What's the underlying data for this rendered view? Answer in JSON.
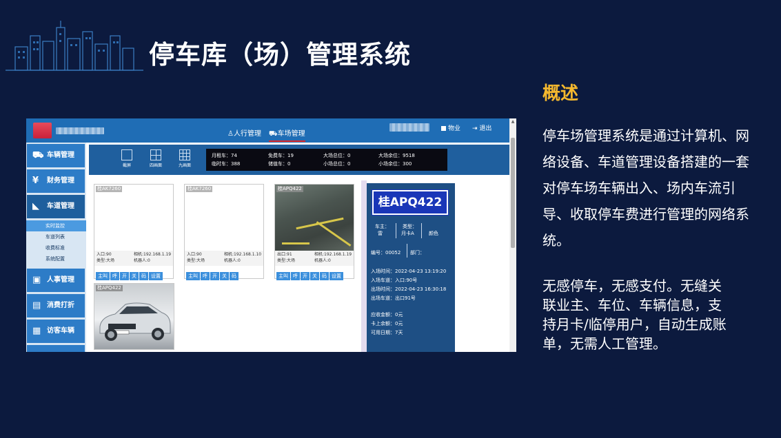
{
  "slide": {
    "title": "停车库（场）管理系统",
    "section_title": "概述",
    "paragraph_1": "停车场管理系统是通过计算机、网络设备、车道管理设备搭建的一套对停车场车辆出入、场内车流引导、收取停车费进行管理的网络系统。",
    "paragraph_2": "无感停车，无感支付。无缝关联业主、车位、车辆信息，支持月卡/临停用户，自动生成账单，无需人工管理。"
  },
  "app": {
    "nav": [
      {
        "label": "人行管理",
        "icon": "person-icon"
      },
      {
        "label": "车场管理",
        "icon": "car-icon",
        "active": true
      }
    ],
    "header_links": [
      {
        "label": "物业",
        "icon": "square-icon"
      },
      {
        "label": "退出",
        "icon": "exit-icon"
      }
    ],
    "sidebar": {
      "items": [
        {
          "label": "车辆管理",
          "icon": "car-icon"
        },
        {
          "label": "财务管理",
          "icon": "yen-icon"
        },
        {
          "label": "车道管理",
          "icon": "camera-icon"
        },
        {
          "label": "人事管理",
          "icon": "id-card-icon"
        },
        {
          "label": "消费打折",
          "icon": "discount-icon"
        },
        {
          "label": "访客车辆",
          "icon": "visitor-icon"
        }
      ],
      "sub_items": [
        {
          "label": "实时监控",
          "active": true
        },
        {
          "label": "车道列表"
        },
        {
          "label": "收费标准"
        },
        {
          "label": "系统配置"
        }
      ]
    },
    "toolbar": {
      "tools": [
        {
          "label": "截屏",
          "icon": "screenshot-icon"
        },
        {
          "label": "四画面",
          "icon": "grid-4-icon"
        },
        {
          "label": "九画面",
          "icon": "grid-9-icon"
        }
      ],
      "stats": [
        {
          "label": "月租车：",
          "value": "74"
        },
        {
          "label": "临时车：",
          "value": "388"
        },
        {
          "label": "免费车：",
          "value": "19"
        },
        {
          "label": "储值车：",
          "value": "0"
        },
        {
          "label": "大场总位：",
          "value": "0"
        },
        {
          "label": "小场总位：",
          "value": "0"
        },
        {
          "label": "大场余位：",
          "value": "9518"
        },
        {
          "label": "小场余位：",
          "value": "300"
        }
      ]
    },
    "cameras": [
      {
        "tag": "桂AK7260",
        "lane": "入口:90",
        "ip": "相机:192.168.1.19",
        "type": "类型:大场",
        "robot": "机器人:0",
        "buttons": [
          "主叫",
          "呼",
          "开",
          "关",
          "码",
          "设置"
        ]
      },
      {
        "tag": "桂AK7260",
        "lane": "入口:90",
        "ip": "相机:192.168.1.10",
        "type": "类型:大场",
        "robot": "机器人:0",
        "buttons": [
          "主叫",
          "呼",
          "开",
          "关",
          "码"
        ]
      },
      {
        "tag": "桂APQ422",
        "lane": "出口:91",
        "ip": "相机:192.168.1.19",
        "type": "类型:大场",
        "robot": "机器人:0",
        "buttons": [
          "主叫",
          "呼",
          "开",
          "关",
          "码",
          "设置"
        ]
      }
    ],
    "car_photo_tag": "桂APQ422",
    "info_panel": {
      "plate": "桂APQ422",
      "owner_label": "车主：",
      "owner_value": "雷",
      "type_label": "类型：",
      "type_value": "月卡A",
      "color_label": "颜色",
      "number": "编号：00052",
      "dept": "部门：",
      "entry_time": "入场时间：2022-04-23 13:19:20",
      "entry_lane": "入场车道：入口:90号",
      "exit_time": "出场时间：2022-04-23 16:30:18",
      "exit_lane": "出场车道：出口91号",
      "due": "应收金额：0元",
      "balance": "卡上余额：0元",
      "valid_days": "可用日期：7天"
    }
  }
}
